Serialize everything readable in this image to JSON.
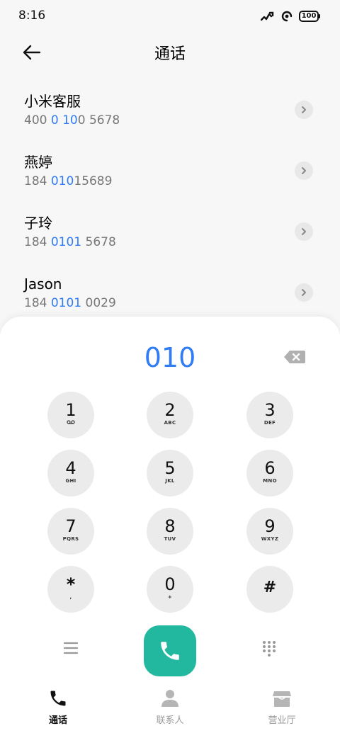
{
  "status_bar": {
    "time": "8:16",
    "battery": "100"
  },
  "header": {
    "title": "通话"
  },
  "results": [
    {
      "name": "小米客服",
      "number_parts": [
        {
          "t": "400 ",
          "h": false
        },
        {
          "t": "0 10",
          "h": true
        },
        {
          "t": "0 5678",
          "h": false
        }
      ]
    },
    {
      "name": "燕婷",
      "number_parts": [
        {
          "t": "184 ",
          "h": false
        },
        {
          "t": "010",
          "h": true
        },
        {
          "t": "15689",
          "h": false
        }
      ]
    },
    {
      "name": "子玲",
      "number_parts": [
        {
          "t": "184 ",
          "h": false
        },
        {
          "t": "0101",
          "h": true
        },
        {
          "t": " 5678",
          "h": false
        }
      ]
    },
    {
      "name": "Jason",
      "number_parts": [
        {
          "t": "184 ",
          "h": false
        },
        {
          "t": "0101",
          "h": true
        },
        {
          "t": " 0029",
          "h": false
        }
      ]
    }
  ],
  "dialer": {
    "input": "010",
    "keys": [
      {
        "digit": "1",
        "letters": "⌕"
      },
      {
        "digit": "2",
        "letters": "ABC"
      },
      {
        "digit": "3",
        "letters": "DEF"
      },
      {
        "digit": "4",
        "letters": "GHI"
      },
      {
        "digit": "5",
        "letters": "JKL"
      },
      {
        "digit": "6",
        "letters": "MNO"
      },
      {
        "digit": "7",
        "letters": "PQRS"
      },
      {
        "digit": "8",
        "letters": "TUV"
      },
      {
        "digit": "9",
        "letters": "WXYZ"
      },
      {
        "digit": "*",
        "letters": ","
      },
      {
        "digit": "0",
        "letters": "+"
      },
      {
        "digit": "#",
        "letters": ""
      }
    ]
  },
  "bottom_nav": [
    {
      "label": "通话",
      "icon": "phone-icon",
      "active": true
    },
    {
      "label": "联系人",
      "icon": "contacts-icon",
      "active": false
    },
    {
      "label": "营业厅",
      "icon": "store-icon",
      "active": false
    }
  ],
  "colors": {
    "accent": "#2f7cf6",
    "call": "#22b8a0",
    "key_bg": "#ebebeb"
  }
}
